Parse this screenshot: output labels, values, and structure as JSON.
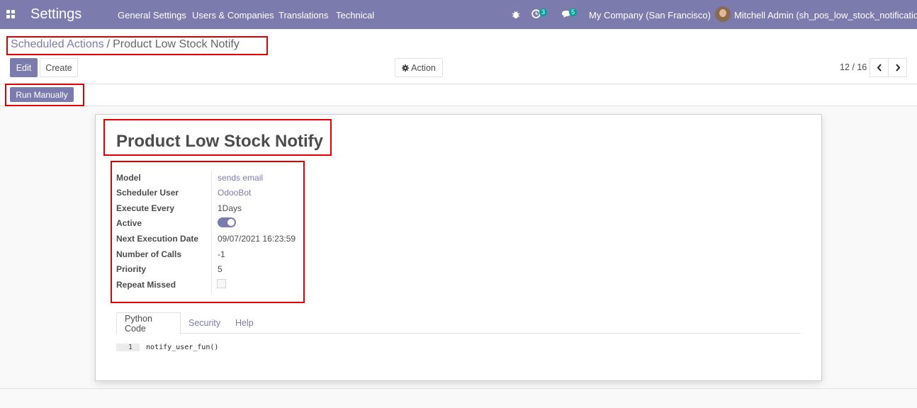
{
  "navbar": {
    "brand": "Settings",
    "menu": [
      "General Settings",
      "Users & Companies",
      "Translations",
      "Technical"
    ],
    "activity_badge": "3",
    "messages_badge": "5",
    "company": "My Company (San Francisco)",
    "user": "Mitchell Admin (sh_pos_low_stock_notification)"
  },
  "breadcrumb": {
    "parent": "Scheduled Actions",
    "separator": "/",
    "current": "Product Low Stock Notify"
  },
  "buttons": {
    "edit": "Edit",
    "create": "Create",
    "action": "Action",
    "run_manually": "Run Manually"
  },
  "pager": {
    "value": "12 / 16"
  },
  "record": {
    "title": "Product Low Stock Notify",
    "fields": [
      {
        "label": "Model",
        "value": "sends email"
      },
      {
        "label": "Scheduler User",
        "value": "OdooBot"
      },
      {
        "label": "Execute Every",
        "value": "1Days"
      },
      {
        "label": "Active",
        "value": ""
      },
      {
        "label": "Next Execution Date",
        "value": "09/07/2021 16:23:59"
      },
      {
        "label": "Number of Calls",
        "value": "-1"
      },
      {
        "label": "Priority",
        "value": "5"
      },
      {
        "label": "Repeat Missed",
        "value": ""
      }
    ],
    "active": true,
    "repeat_missed": false
  },
  "tabs": [
    "Python Code",
    "Security",
    "Help"
  ],
  "code": {
    "line_number": "1",
    "text": "notify_user_fun()"
  },
  "colors": {
    "primary": "#7c7bad",
    "annotation": "#e00000"
  }
}
